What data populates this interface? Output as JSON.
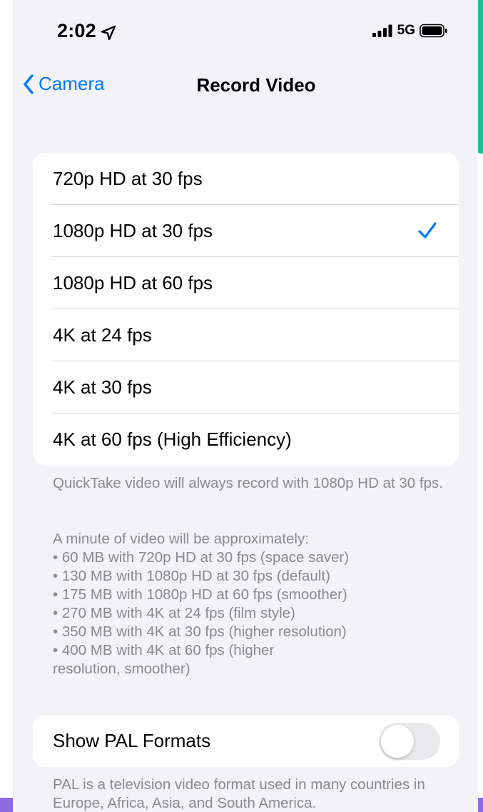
{
  "status_bar": {
    "time": "2:02",
    "network": "5G",
    "icons": [
      "location-arrow-icon",
      "cellular-signal-icon",
      "battery-icon"
    ]
  },
  "nav": {
    "back_label": "Camera",
    "title": "Record Video"
  },
  "options": [
    {
      "label": "720p HD at 30 fps",
      "selected": false
    },
    {
      "label": "1080p HD at 30 fps",
      "selected": true
    },
    {
      "label": "1080p HD at 60 fps",
      "selected": false
    },
    {
      "label": "4K at 24 fps",
      "selected": false
    },
    {
      "label": "4K at 30 fps",
      "selected": false
    },
    {
      "label": "4K at 60 fps (High Efficiency)",
      "selected": false
    }
  ],
  "footnotes": {
    "quicktake": "QuickTake video will always record with 1080p HD at 30 fps.",
    "sizes_intro": "A minute of video will be approximately:",
    "sizes": [
      "• 60 MB with 720p HD at 30 fps (space saver)",
      "• 130 MB with 1080p HD at 30 fps (default)",
      "• 175 MB with 1080p HD at 60 fps (smoother)",
      "• 270 MB with 4K at 24 fps (film style)",
      "• 350 MB with 4K at 30 fps (higher resolution)",
      "• 400 MB with 4K at 60 fps (higher",
      "resolution, smoother)"
    ]
  },
  "pal": {
    "label": "Show PAL Formats",
    "enabled": false,
    "note": "PAL is a television video format used in many countries in Europe, Africa, Asia, and South America."
  },
  "colors": {
    "accent": "#007aff",
    "background": "#f2f2f7",
    "secondary_text": "#8a8a8e",
    "toggle_off": "#e9e9eb"
  }
}
